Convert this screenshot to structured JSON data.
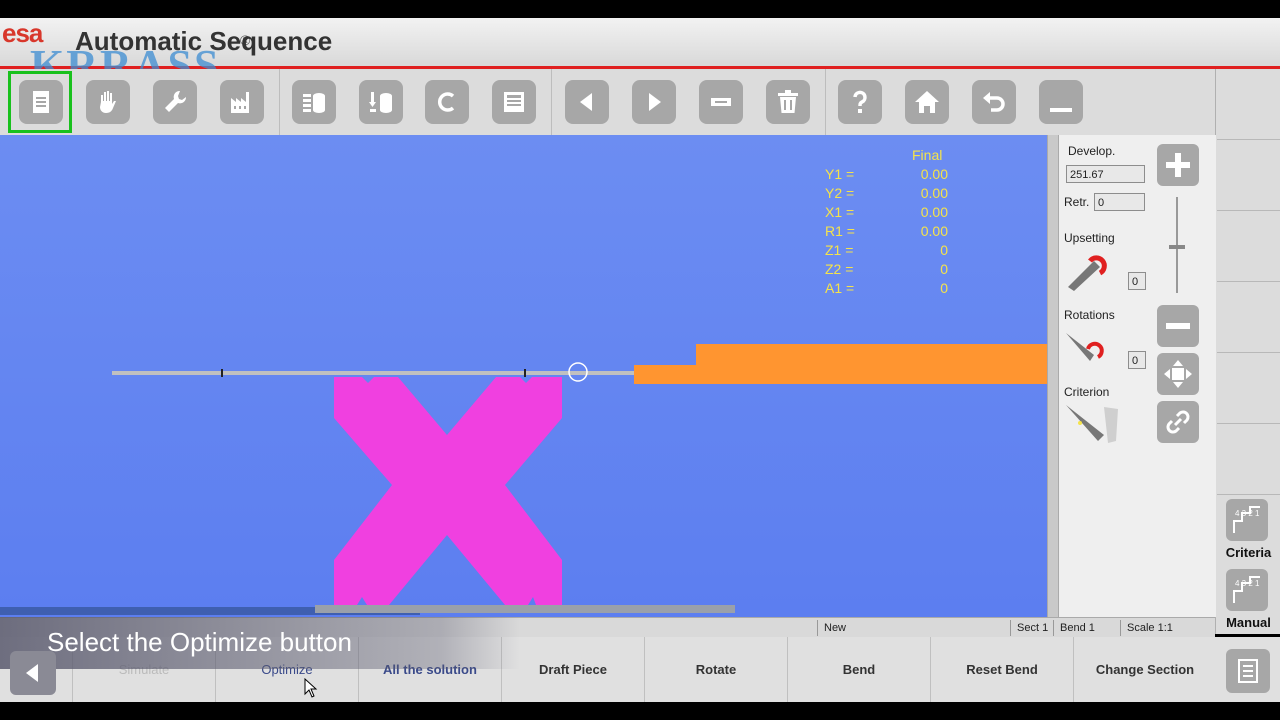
{
  "app": {
    "logo": "esa",
    "watermark": "KRRASS",
    "registered": "®",
    "title": "Automatic Sequence"
  },
  "toolbar": {
    "buttons": [
      {
        "icon": "document-icon",
        "active": true
      },
      {
        "icon": "hand-icon"
      },
      {
        "icon": "wrench-icon"
      },
      {
        "icon": "factory-icon"
      },
      {
        "icon": "database-icon"
      },
      {
        "icon": "sequence-database-icon"
      },
      {
        "icon": "c-letter-icon"
      },
      {
        "icon": "save-icon"
      },
      {
        "icon": "arrow-left-icon"
      },
      {
        "icon": "arrow-right-icon"
      },
      {
        "icon": "minus-box-icon"
      },
      {
        "icon": "trash-icon"
      },
      {
        "icon": "help-icon"
      },
      {
        "icon": "home-icon"
      },
      {
        "icon": "undo-icon"
      },
      {
        "icon": "minimize-icon"
      }
    ]
  },
  "readout": {
    "header": "Final",
    "rows": [
      {
        "label": "Y1 =",
        "value": "0.00"
      },
      {
        "label": "Y2 =",
        "value": "0.00"
      },
      {
        "label": "X1 =",
        "value": "0.00"
      },
      {
        "label": "R1 =",
        "value": "0.00"
      },
      {
        "label": "Z1 =",
        "value": "0"
      },
      {
        "label": "Z2 =",
        "value": "0"
      },
      {
        "label": "A1 =",
        "value": "0"
      }
    ]
  },
  "panel": {
    "develop_label": "Develop.",
    "develop_value": "251.67",
    "retr_label": "Retr.",
    "retr_value": "0",
    "upsetting_label": "Upsetting",
    "upsetting_value": "0",
    "rotations_label": "Rotations",
    "rotations_value": "0",
    "criterion_label": "Criterion"
  },
  "right_column": {
    "criteria_label": "Criteria",
    "manual_label": "Manual",
    "criteria_icon_digits": "4 3 2 1",
    "manual_icon_digits": "4 3 2 1"
  },
  "status": {
    "state": "New",
    "sect": "Sect 1",
    "bend": "Bend 1",
    "scale": "Scale 1:1"
  },
  "bottom": {
    "buttons": [
      "Simulate",
      "Optimize",
      "All the solution",
      "Draft Piece",
      "Rotate",
      "Bend",
      "Reset Bend",
      "Change Section"
    ]
  },
  "caption": "Select the Optimize button",
  "colors": {
    "canvas": "#6484f2",
    "tool": "#f040e0",
    "sheet": "#ff9530",
    "readout": "#f5e34a",
    "active_outline": "#19c11d"
  }
}
